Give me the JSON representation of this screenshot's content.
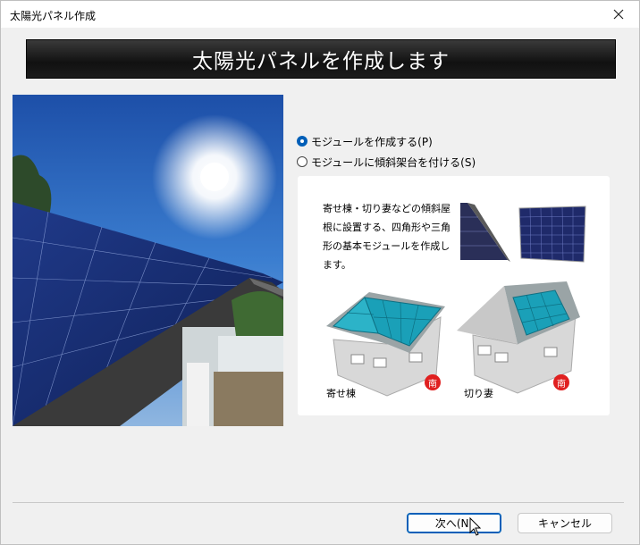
{
  "window": {
    "title": "太陽光パネル作成"
  },
  "banner": {
    "heading": "太陽光パネルを作成します"
  },
  "options": [
    {
      "label": "モジュールを作成する(P)",
      "checked": true
    },
    {
      "label": "モジュールに傾斜架台を付ける(S)",
      "checked": false
    }
  ],
  "info": {
    "description": "寄せ棟・切り妻などの傾斜屋根に設置する、四角形や三角形の基本モジュールを作成します。",
    "house_left_label": "寄せ棟",
    "house_right_label": "切り妻",
    "south_badge": "南"
  },
  "buttons": {
    "next": "次へ(N)",
    "cancel": "キャンセル"
  },
  "colors": {
    "accent": "#005fb8",
    "banner_bg": "#1a1a1a",
    "panel_teal": "#1aa0b8",
    "south_red": "#e02020"
  }
}
